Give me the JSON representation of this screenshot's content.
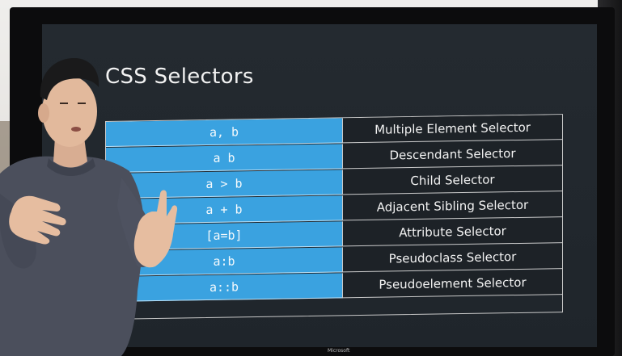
{
  "slide": {
    "title": "CSS Selectors",
    "rows": [
      {
        "code": "a, b",
        "name": "Multiple Element Selector"
      },
      {
        "code": "a b",
        "name": "Descendant Selector"
      },
      {
        "code": "a > b",
        "name": "Child Selector"
      },
      {
        "code": "a + b",
        "name": "Adjacent Sibling Selector"
      },
      {
        "code": "[a=b]",
        "name": "Attribute Selector"
      },
      {
        "code": "a:b",
        "name": "Pseudoclass Selector"
      },
      {
        "code": "a::b",
        "name": "Pseudoelement Selector"
      }
    ]
  },
  "colors": {
    "code_cell": "#3aa2e0",
    "name_cell": "#1d2227",
    "screen": "#242a30",
    "sweater": "#4b4f5c"
  },
  "monitor_brand": "Microsoft"
}
